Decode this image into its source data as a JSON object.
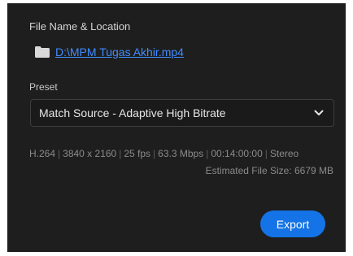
{
  "output": {
    "file_label": "File Name & Location",
    "file_path": "D:\\MPM Tugas Akhir.mp4",
    "preset_label": "Preset",
    "preset_value": "Match Source - Adaptive High Bitrate",
    "summary": {
      "codec": "H.264",
      "resolution": "3840 x 2160",
      "frame_rate": "25 fps",
      "bitrate": "63.3 Mbps",
      "duration": "00:14:00:00",
      "audio": "Stereo",
      "separator": "|"
    },
    "estimated_size": "Estimated File Size: 6679 MB",
    "export_label": "Export"
  },
  "colors": {
    "panel_background": "#1e1e1e",
    "link": "#3f8cff",
    "accent_button": "#1473e6",
    "muted_text": "#8a8a8a"
  },
  "icons": {
    "folder": "folder-icon",
    "dropdown": "chevron-down-icon"
  }
}
